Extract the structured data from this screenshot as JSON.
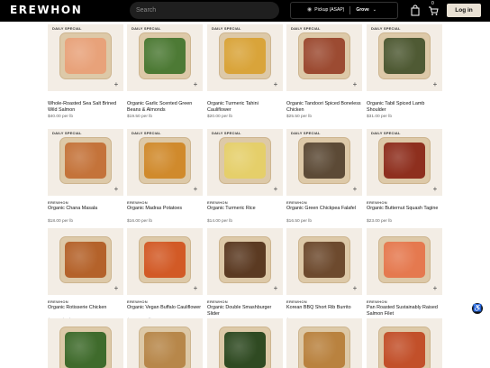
{
  "header": {
    "logo": "EREWHON",
    "search_placeholder": "Search",
    "pickup_label": "Pickup (ASAP)",
    "store_label": "Grove",
    "cart_count": "0",
    "login_label": "Log in"
  },
  "accessibility_icon": "accessibility-icon",
  "products": [
    {
      "badge": "DAILY SPECIAL",
      "brand": "",
      "name": "Whole-Roasted Sea Salt Brined Wild Salmon",
      "price": "$40.00 per lb",
      "food_color": "#e8a27a"
    },
    {
      "badge": "DAILY SPECIAL",
      "brand": "",
      "name": "Organic Garlic Scented Green Beans & Almonds",
      "price": "$19.50 per lb",
      "food_color": "#4d7a35"
    },
    {
      "badge": "DAILY SPECIAL",
      "brand": "",
      "name": "Organic Turmeric Tahini Cauliflower",
      "price": "$20.00 per lb",
      "food_color": "#d9a43a"
    },
    {
      "badge": "DAILY SPECIAL",
      "brand": "",
      "name": "Organic Tandoori Spiced Boneless Chicken",
      "price": "$25.50 per lb",
      "food_color": "#9c4b32"
    },
    {
      "badge": "DAILY SPECIAL",
      "brand": "",
      "name": "Organic Tabil Spiced Lamb Shoulder",
      "price": "$31.00 per lb",
      "food_color": "#4f5a34"
    },
    {
      "badge": "DAILY SPECIAL",
      "brand": "EREWHON",
      "name": "Organic Chana Masala",
      "price": "$18.00 per lb",
      "food_color": "#c4733a"
    },
    {
      "badge": "DAILY SPECIAL",
      "brand": "EREWHON",
      "name": "Organic Madras Potatoes",
      "price": "$16.00 per lb",
      "food_color": "#d08a2c"
    },
    {
      "badge": "DAILY SPECIAL",
      "brand": "EREWHON",
      "name": "Organic Turmeric Rice",
      "price": "$14.00 per lb",
      "food_color": "#e5cf6a"
    },
    {
      "badge": "DAILY SPECIAL",
      "brand": "EREWHON",
      "name": "Organic Green Chickpea Falafel",
      "price": "$16.50 per lb",
      "food_color": "#5c4a36"
    },
    {
      "badge": "DAILY SPECIAL",
      "brand": "EREWHON",
      "name": "Organic Butternut Squash Tagine",
      "price": "$23.00 per lb",
      "food_color": "#8e2f1e"
    },
    {
      "badge": "",
      "brand": "EREWHON",
      "name": "Organic Rotisserie Chicken",
      "price": "$23.75 (set)",
      "food_color": "#b4622a"
    },
    {
      "badge": "",
      "brand": "EREWHON",
      "name": "Organic Vegan Buffalo Cauliflower",
      "price": "$20.00 per lb",
      "food_color": "#d25a26"
    },
    {
      "badge": "",
      "brand": "EREWHON",
      "name": "Organic Double Smashburger Slider",
      "price": "",
      "food_color": "#5b3a22"
    },
    {
      "badge": "",
      "brand": "EREWHON",
      "name": "Korean BBQ Short Rib Burrito",
      "price": "$20.00",
      "food_color": "#6d4a2e"
    },
    {
      "badge": "",
      "brand": "EREWHON",
      "name": "Pan Roasted Sustainably Raised Salmon Filet",
      "price": "",
      "food_color": "#e5794f"
    },
    {
      "badge": "",
      "brand": "",
      "name": "",
      "price": "",
      "food_color": "#3f6b2c"
    },
    {
      "badge": "",
      "brand": "",
      "name": "",
      "price": "",
      "food_color": "#b7874a"
    },
    {
      "badge": "",
      "brand": "",
      "name": "",
      "price": "",
      "food_color": "#2f4a22"
    },
    {
      "badge": "",
      "brand": "",
      "name": "",
      "price": "",
      "food_color": "#b9823f"
    },
    {
      "badge": "",
      "brand": "",
      "name": "",
      "price": "",
      "food_color": "#c2502a"
    }
  ]
}
